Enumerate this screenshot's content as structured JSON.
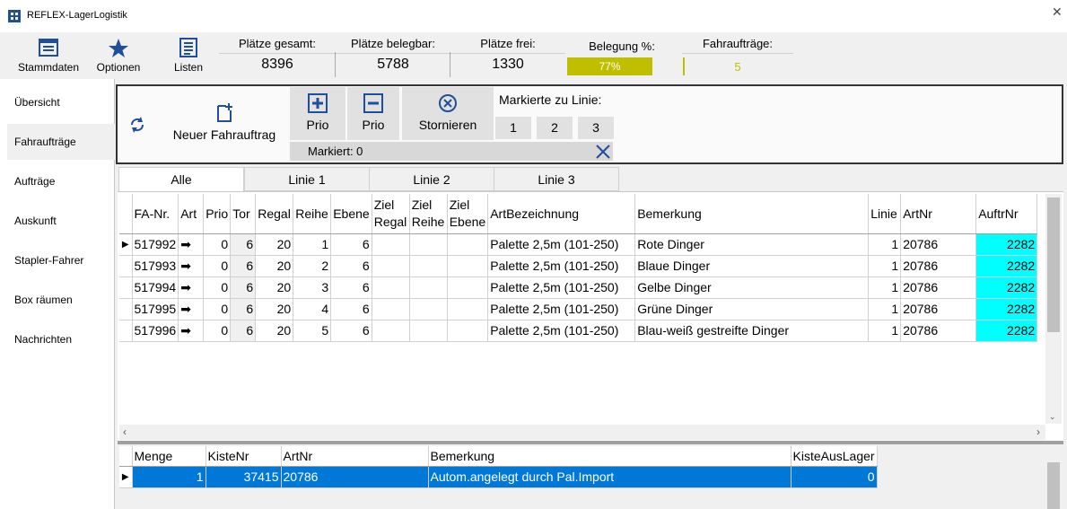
{
  "window": {
    "title": "REFLEX-LagerLogistik",
    "close_glyph": "✕"
  },
  "toolbar": {
    "buttons": [
      {
        "label": "Stammdaten",
        "icon": "document-icon"
      },
      {
        "label": "Optionen",
        "icon": "star-icon"
      },
      {
        "label": "Listen",
        "icon": "list-icon"
      }
    ],
    "stats": {
      "plaetze_gesamt": {
        "label": "Plätze gesamt:",
        "value": "8396"
      },
      "plaetze_belegbar": {
        "label": "Plätze belegbar:",
        "value": "5788"
      },
      "plaetze_frei": {
        "label": "Plätze frei:",
        "value": "1330"
      },
      "belegung": {
        "label": "Belegung %:",
        "value": "77%",
        "fraction": 0.77,
        "color": "#bfbf00"
      },
      "fahrauftraege": {
        "label": "Fahraufträge:",
        "value": "5",
        "color": "#bfbf00"
      }
    }
  },
  "nav": {
    "items": [
      "Übersicht",
      "Fahraufträge",
      "Aufträge",
      "Auskunft",
      "Stapler-Fahrer",
      "Box räumen",
      "Nachrichten"
    ],
    "active": "Fahraufträge"
  },
  "actions": {
    "new_order": "Neuer Fahrauftrag",
    "prio_up": "Prio",
    "prio_down": "Prio",
    "cancel": "Stornieren",
    "mark_to_line": "Markierte zu Linie:",
    "line_buttons": [
      "1",
      "2",
      "3"
    ],
    "marked": "Markiert: 0"
  },
  "tabs": [
    "Alle",
    "Linie 1",
    "Linie 2",
    "Linie 3"
  ],
  "orders": {
    "columns": [
      "FA-Nr.",
      "Art",
      "Prio",
      "Tor",
      "Regal",
      "Reihe",
      "Ebene",
      "Ziel Regal",
      "Ziel Reihe",
      "Ziel Ebene",
      "ArtBezeichnung",
      "Bemerkung",
      "Linie",
      "ArtNr",
      "AuftrNr"
    ],
    "rows": [
      [
        "517992",
        "➡",
        "0",
        "6",
        "20",
        "1",
        "6",
        "",
        "",
        "",
        "Palette 2,5m (101-250)",
        "Rote Dinger",
        "1",
        "20786",
        "2282"
      ],
      [
        "517993",
        "➡",
        "0",
        "6",
        "20",
        "2",
        "6",
        "",
        "",
        "",
        "Palette 2,5m (101-250)",
        "Blaue Dinger",
        "1",
        "20786",
        "2282"
      ],
      [
        "517994",
        "➡",
        "0",
        "6",
        "20",
        "3",
        "6",
        "",
        "",
        "",
        "Palette 2,5m (101-250)",
        "Gelbe Dinger",
        "1",
        "20786",
        "2282"
      ],
      [
        "517995",
        "➡",
        "0",
        "6",
        "20",
        "4",
        "6",
        "",
        "",
        "",
        "Palette 2,5m (101-250)",
        "Grüne Dinger",
        "1",
        "20786",
        "2282"
      ],
      [
        "517996",
        "➡",
        "0",
        "6",
        "20",
        "5",
        "6",
        "",
        "",
        "",
        "Palette 2,5m (101-250)",
        "Blau-weiß gestreifte Dinger",
        "1",
        "20786",
        "2282"
      ]
    ]
  },
  "details": {
    "columns": [
      "Menge",
      "KisteNr",
      "ArtNr",
      "Bemerkung",
      "KisteAusLager"
    ],
    "rows": [
      [
        "1",
        "37415",
        "20786",
        "Autom.angelegt durch Pal.Import",
        "0"
      ]
    ]
  },
  "colors": {
    "accent": "#0078d7",
    "highlight": "#00ffff",
    "icon_blue": "#1f4e9a"
  }
}
